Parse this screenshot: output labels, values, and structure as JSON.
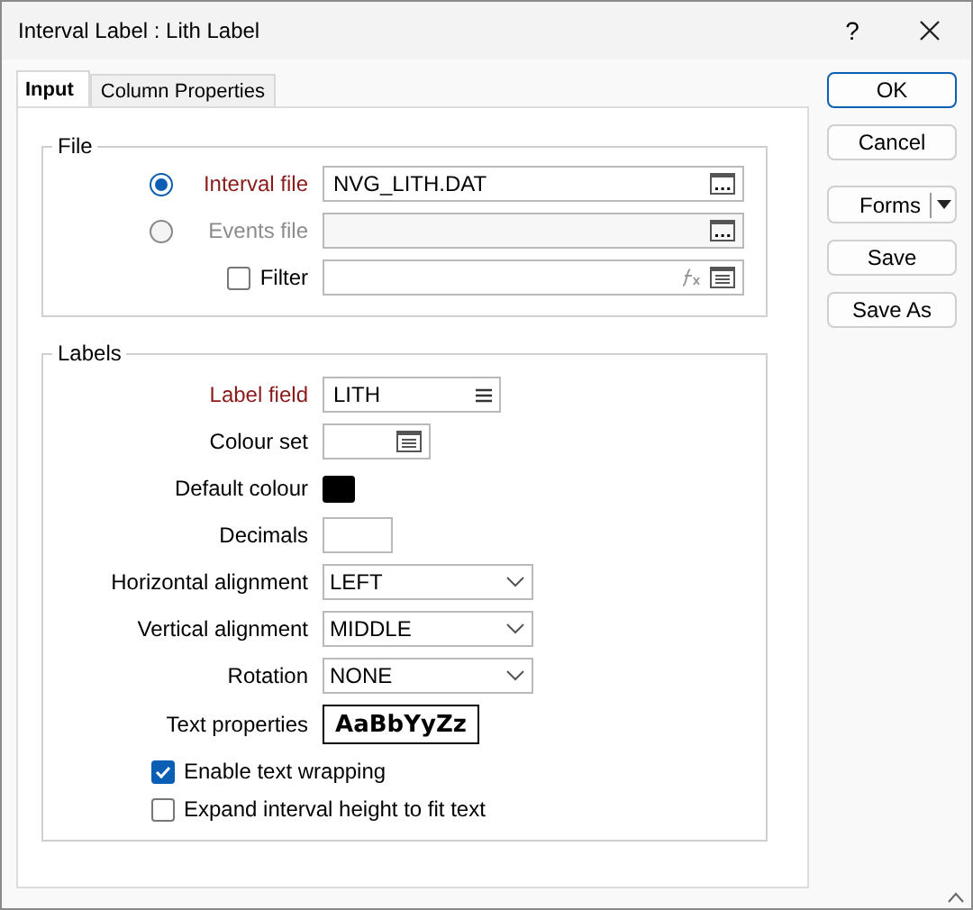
{
  "window": {
    "title": "Interval Label : Lith Label",
    "help": "?"
  },
  "tabs": [
    {
      "label": "Input",
      "selected": true
    },
    {
      "label": "Column Properties",
      "selected": false
    }
  ],
  "file_group": {
    "title": "File",
    "rows": [
      {
        "kind": "radio",
        "label": "Interval file",
        "selected": true,
        "required": true,
        "disabled": false,
        "value": "NVG_LITH.DAT"
      },
      {
        "kind": "radio",
        "label": "Events file",
        "selected": false,
        "required": false,
        "disabled": true
      },
      {
        "kind": "checkbox",
        "label": "Filter",
        "checked": false,
        "required": false,
        "disabled": false
      }
    ]
  },
  "labels_group": {
    "title": "Labels",
    "fields": [
      {
        "kind": "text",
        "label": "Label field",
        "value": "LITH",
        "required": true
      },
      {
        "kind": "list",
        "label": "Colour set",
        "required": false
      },
      {
        "kind": "color",
        "label": "Default colour",
        "color": "#000000",
        "required": false
      },
      {
        "kind": "number",
        "label": "Decimals",
        "required": false
      },
      {
        "kind": "select",
        "label": "Horizontal alignment",
        "value": "LEFT",
        "required": false
      },
      {
        "kind": "select",
        "label": "Vertical alignment",
        "value": "MIDDLE",
        "required": false
      },
      {
        "kind": "select",
        "label": "Rotation",
        "value": "NONE",
        "required": false
      },
      {
        "kind": "font",
        "label": "Text properties",
        "sample": "AaBbYyZz",
        "required": false
      }
    ],
    "options": [
      {
        "label": "Enable text wrapping",
        "checked": true
      },
      {
        "label": "Expand interval height to fit text",
        "checked": false
      }
    ]
  },
  "buttons": [
    {
      "label": "OK",
      "kind": "default"
    },
    {
      "label": "Cancel",
      "kind": "plain"
    },
    {
      "label": "Forms",
      "kind": "split"
    },
    {
      "label": "Save",
      "kind": "plain"
    },
    {
      "label": "Save As",
      "kind": "plain"
    }
  ]
}
